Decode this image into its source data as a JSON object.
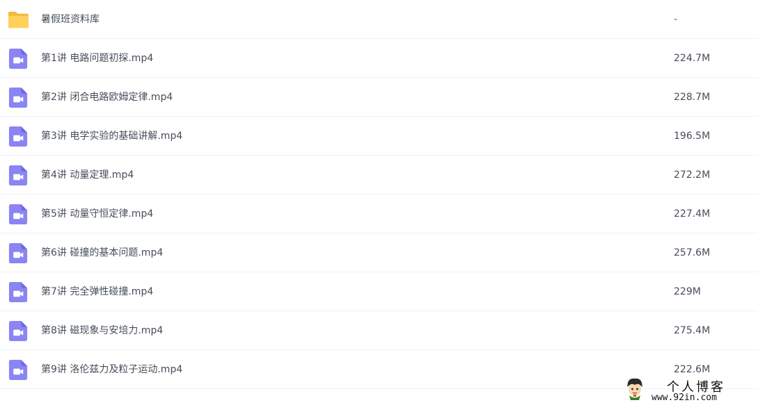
{
  "files": [
    {
      "name": "暑假班资料库",
      "size": "-",
      "type": "folder",
      "icon": "folder-icon"
    },
    {
      "name": "第1讲 电路问题初探.mp4",
      "size": "224.7M",
      "type": "video",
      "icon": "video-file-icon"
    },
    {
      "name": "第2讲 闭合电路欧姆定律.mp4",
      "size": "228.7M",
      "type": "video",
      "icon": "video-file-icon"
    },
    {
      "name": "第3讲 电学实验的基础讲解.mp4",
      "size": "196.5M",
      "type": "video",
      "icon": "video-file-icon"
    },
    {
      "name": "第4讲 动量定理.mp4",
      "size": "272.2M",
      "type": "video",
      "icon": "video-file-icon"
    },
    {
      "name": "第5讲 动量守恒定律.mp4",
      "size": "227.4M",
      "type": "video",
      "icon": "video-file-icon"
    },
    {
      "name": "第6讲 碰撞的基本问题.mp4",
      "size": "257.6M",
      "type": "video",
      "icon": "video-file-icon"
    },
    {
      "name": "第7讲 完全弹性碰撞.mp4",
      "size": "229M",
      "type": "video",
      "icon": "video-file-icon"
    },
    {
      "name": "第8讲 磁现象与安培力.mp4",
      "size": "275.4M",
      "type": "video",
      "icon": "video-file-icon"
    },
    {
      "name": "第9讲 洛伦兹力及粒子运动.mp4",
      "size": "222.6M",
      "type": "video",
      "icon": "video-file-icon"
    }
  ],
  "colors": {
    "folder": "#fdd15a",
    "folder_dark": "#f5b83a",
    "video": "#8a85f2",
    "text": "#454d5a",
    "divider": "#f0f1f3"
  },
  "watermark": {
    "title": "个人博客",
    "url": "www.92in.com",
    "logo": "cartoon-face-logo"
  }
}
